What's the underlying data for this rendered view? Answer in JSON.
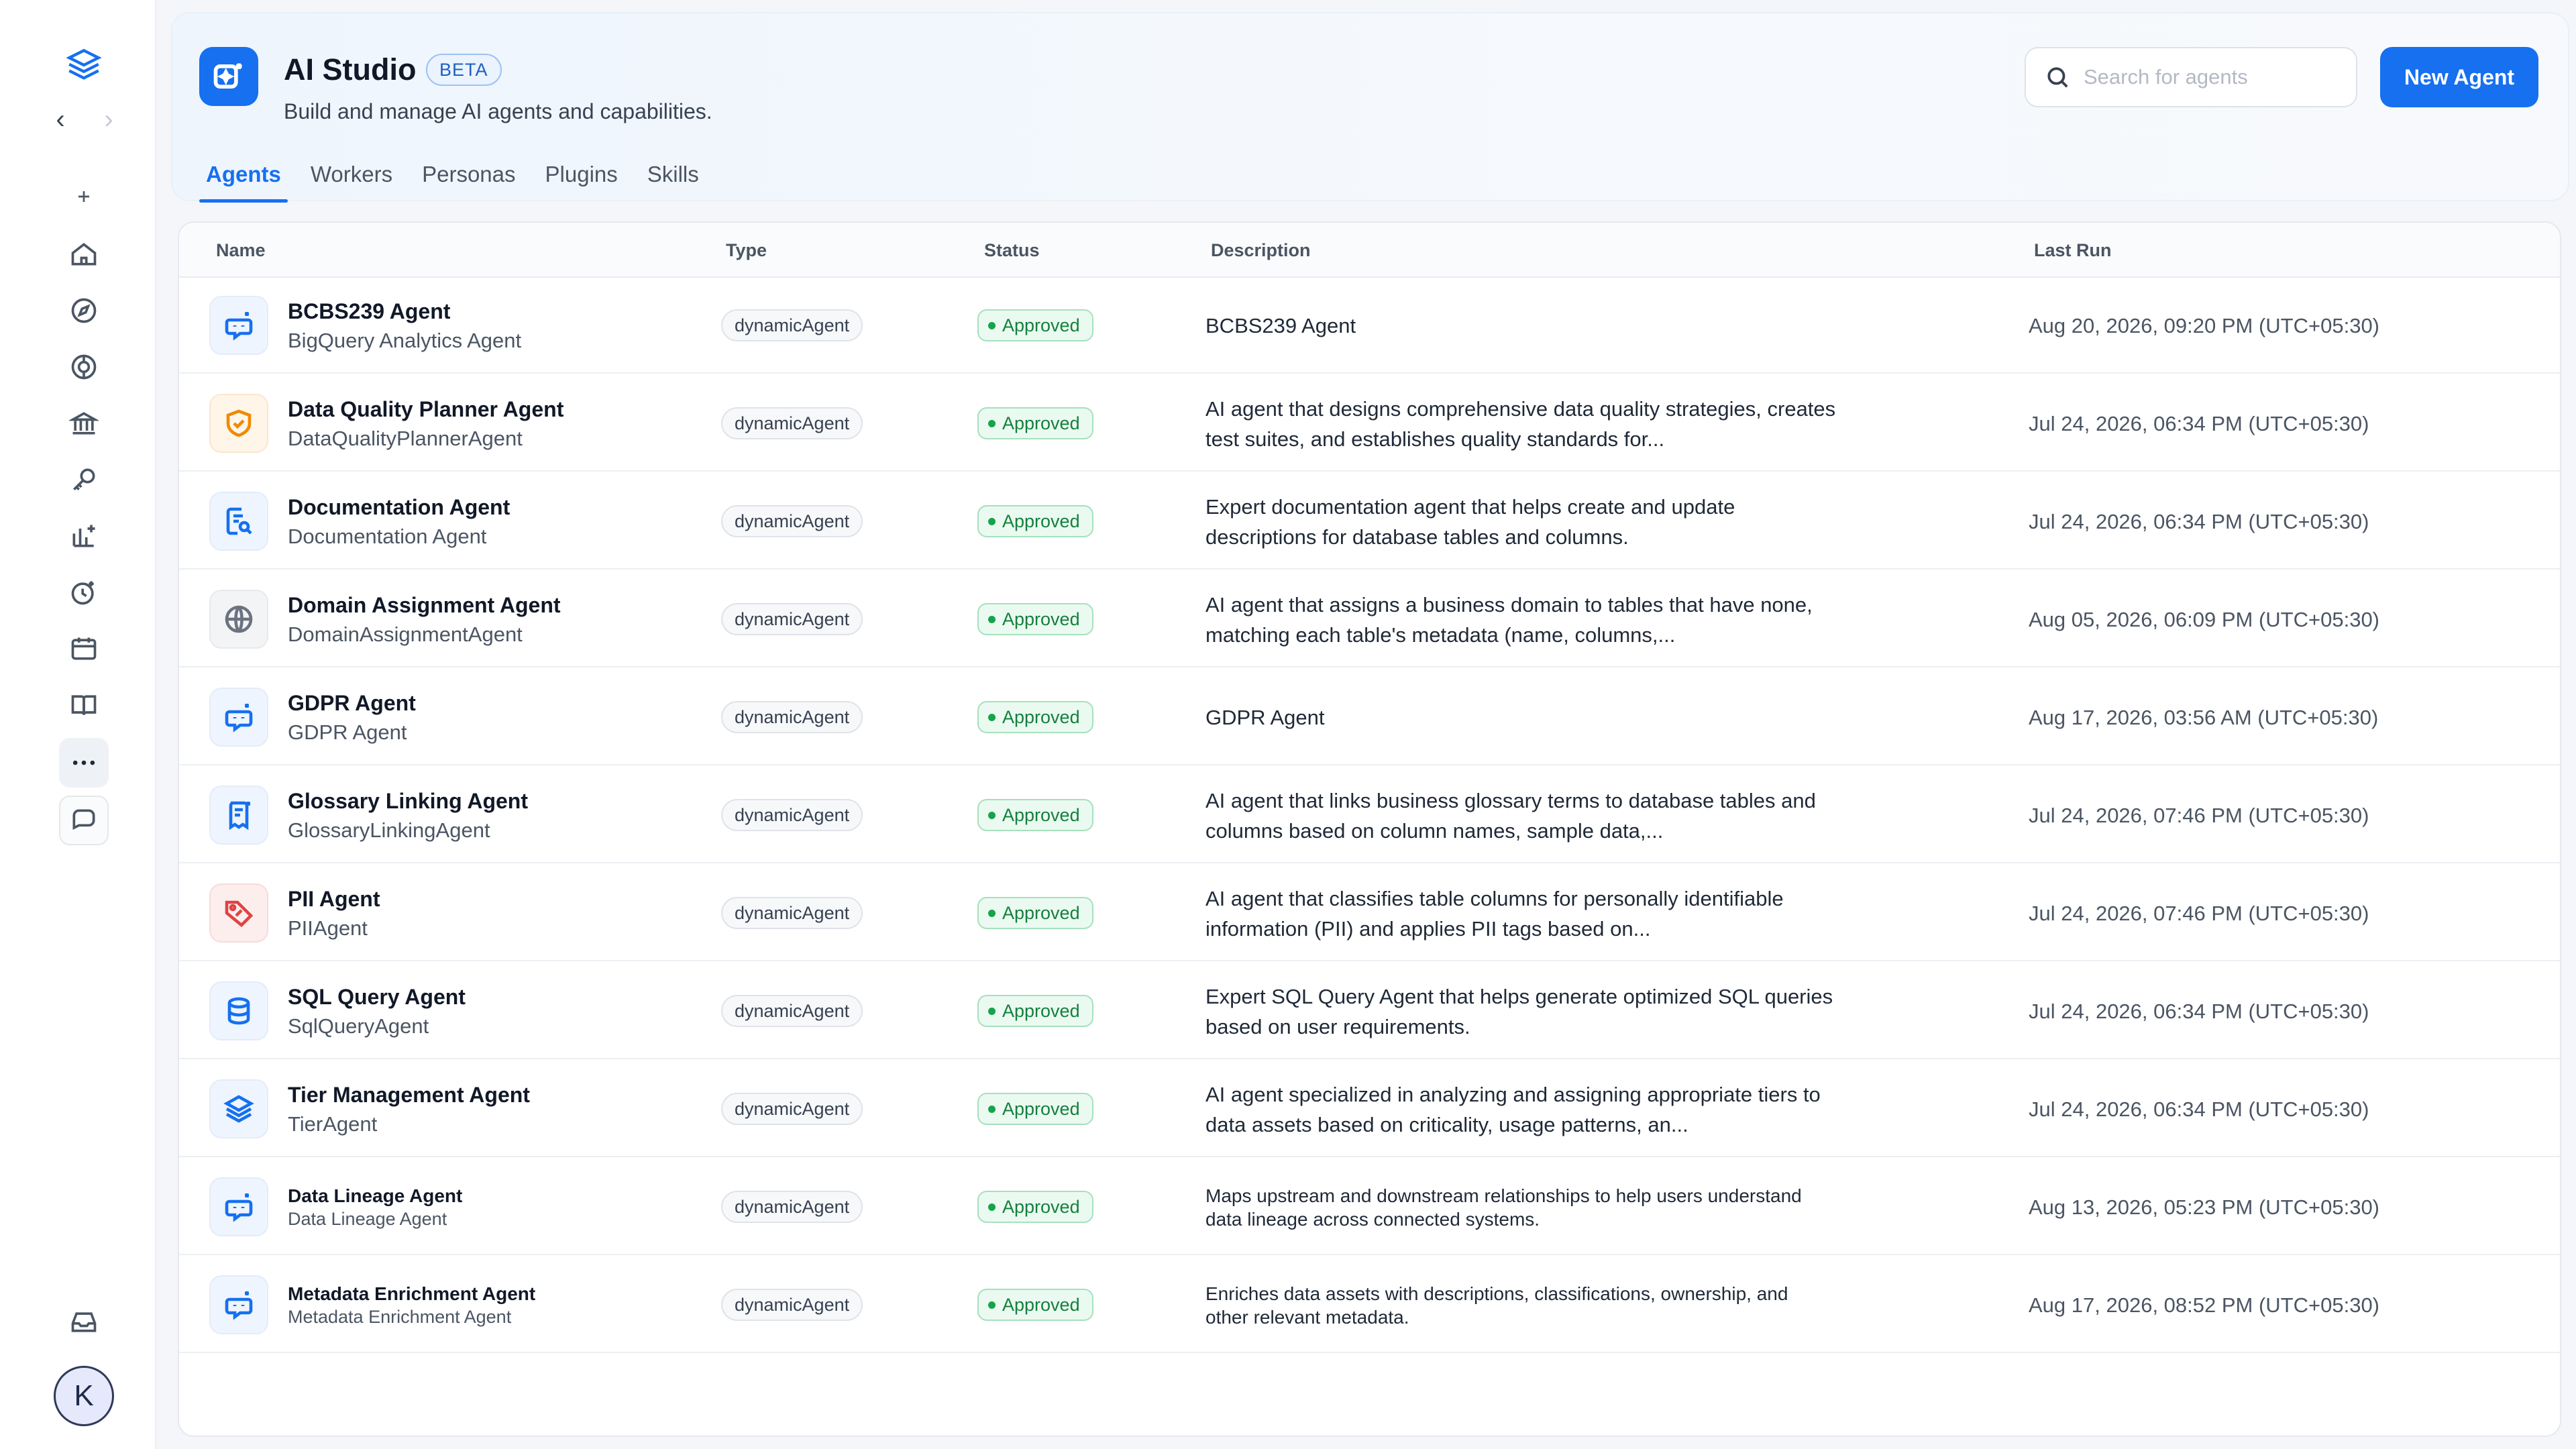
{
  "app": {
    "title": "AI Studio",
    "badge": "BETA",
    "subtitle": "Build and manage AI agents and capabilities."
  },
  "search": {
    "placeholder": "Search for agents",
    "value": ""
  },
  "actions": {
    "new_agent_label": "New Agent"
  },
  "tabs": [
    {
      "label": "Agents",
      "active": true
    },
    {
      "label": "Workers",
      "active": false
    },
    {
      "label": "Personas",
      "active": false
    },
    {
      "label": "Plugins",
      "active": false
    },
    {
      "label": "Skills",
      "active": false
    }
  ],
  "sidebar": {
    "nav_back": "‹",
    "nav_forward": "›",
    "items": [
      {
        "icon": "plus-icon"
      },
      {
        "icon": "home-icon"
      },
      {
        "icon": "compass-icon"
      },
      {
        "icon": "governance-icon"
      },
      {
        "icon": "bank-icon"
      },
      {
        "icon": "key-search-icon"
      },
      {
        "icon": "insights-icon"
      },
      {
        "icon": "clock-spark-icon"
      },
      {
        "icon": "calendar-icon"
      },
      {
        "icon": "book-icon"
      },
      {
        "icon": "more-icon",
        "active": true
      },
      {
        "icon": "chat-icon"
      }
    ],
    "inbox_icon": "inbox-icon",
    "avatar_initial": "K"
  },
  "table": {
    "columns": [
      "Name",
      "Type",
      "Status",
      "Description",
      "Last Run"
    ],
    "rows": [
      {
        "name": "BCBS239 Agent",
        "sub": "BigQuery Analytics Agent",
        "type": "dynamicAgent",
        "status": "Approved",
        "description": "BCBS239 Agent",
        "last_run": "Aug 20, 2026, 09:20 PM (UTC+05:30)",
        "icon": "bot-icon",
        "tone": "blue"
      },
      {
        "name": "Data Quality Planner Agent",
        "sub": "DataQualityPlannerAgent",
        "type": "dynamicAgent",
        "status": "Approved",
        "description": "AI agent that designs comprehensive data quality strategies, creates test suites, and establishes quality standards for...",
        "last_run": "Jul 24, 2026, 06:34 PM (UTC+05:30)",
        "icon": "shield-check-icon",
        "tone": "orange"
      },
      {
        "name": "Documentation Agent",
        "sub": "Documentation Agent",
        "type": "dynamicAgent",
        "status": "Approved",
        "description": "Expert documentation agent that helps create and update descriptions for database tables and columns.",
        "last_run": "Jul 24, 2026, 06:34 PM (UTC+05:30)",
        "icon": "document-search-icon",
        "tone": "blue"
      },
      {
        "name": "Domain Assignment Agent",
        "sub": "DomainAssignmentAgent",
        "type": "dynamicAgent",
        "status": "Approved",
        "description": "AI agent that assigns a business domain to tables that have none, matching each table's metadata (name, columns,...",
        "last_run": "Aug 05, 2026, 06:09 PM (UTC+05:30)",
        "icon": "globe-icon",
        "tone": "grey"
      },
      {
        "name": "GDPR Agent",
        "sub": "GDPR Agent",
        "type": "dynamicAgent",
        "status": "Approved",
        "description": "GDPR Agent",
        "last_run": "Aug 17, 2026, 03:56 AM (UTC+05:30)",
        "icon": "bot-icon",
        "tone": "blue"
      },
      {
        "name": "Glossary Linking Agent",
        "sub": "GlossaryLinkingAgent",
        "type": "dynamicAgent",
        "status": "Approved",
        "description": "AI agent that links business glossary terms to database tables and columns based on column names, sample data,...",
        "last_run": "Jul 24, 2026, 07:46 PM (UTC+05:30)",
        "icon": "glossary-icon",
        "tone": "blue"
      },
      {
        "name": "PII Agent",
        "sub": "PIIAgent",
        "type": "dynamicAgent",
        "status": "Approved",
        "description": "AI agent that classifies table columns for personally identifiable information (PII) and applies PII tags based on...",
        "last_run": "Jul 24, 2026, 07:46 PM (UTC+05:30)",
        "icon": "tag-icon",
        "tone": "red"
      },
      {
        "name": "SQL Query Agent",
        "sub": "SqlQueryAgent",
        "type": "dynamicAgent",
        "status": "Approved",
        "description": "Expert SQL Query Agent that helps generate optimized SQL queries based on user requirements.",
        "last_run": "Jul 24, 2026, 06:34 PM (UTC+05:30)",
        "icon": "database-icon",
        "tone": "blue"
      },
      {
        "name": "Tier Management Agent",
        "sub": "TierAgent",
        "type": "dynamicAgent",
        "status": "Approved",
        "description": "AI agent specialized in analyzing and assigning appropriate tiers to data assets based on criticality, usage patterns, an...",
        "last_run": "Jul 24, 2026, 06:34 PM (UTC+05:30)",
        "icon": "layers-icon",
        "tone": "blue"
      },
      {
        "name": "Data Lineage Agent",
        "sub": "Data Lineage Agent",
        "type": "dynamicAgent",
        "status": "Approved",
        "description": "Maps upstream and downstream relationships to help users understand data lineage across connected systems.",
        "last_run": "Aug 13, 2026, 05:23 PM (UTC+05:30)",
        "icon": "bot-icon",
        "tone": "blue",
        "small": true
      },
      {
        "name": "Metadata Enrichment Agent",
        "sub": "Metadata Enrichment Agent",
        "type": "dynamicAgent",
        "status": "Approved",
        "description": "Enriches data assets with descriptions, classifications, ownership, and other relevant metadata.",
        "last_run": "Aug 17, 2026, 08:52 PM (UTC+05:30)",
        "icon": "bot-icon",
        "tone": "blue",
        "small": true
      }
    ]
  }
}
